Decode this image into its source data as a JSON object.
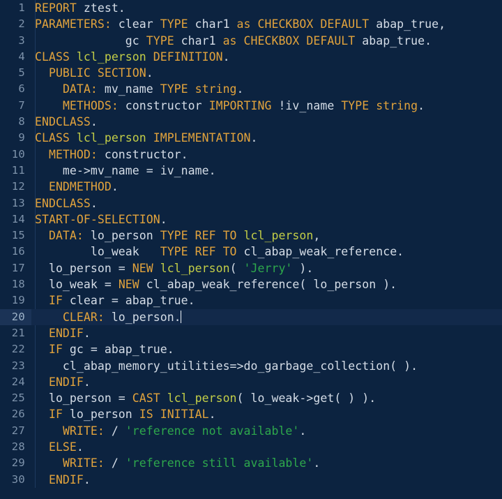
{
  "editor": {
    "name": "abap-code-editor",
    "language": "ABAP",
    "background_color": "#0c2340",
    "gutter_color": "#7e93ab",
    "active_line": 20,
    "cursor_line": 20,
    "cursor_column": 23,
    "first_visible_line": 1,
    "last_visible_line": 30,
    "total_visible_lines": 30,
    "colors": {
      "keyword": "#e2a33c",
      "class_name": "#c3ce47",
      "identifier": "#d5dde7",
      "string": "#2ea84c",
      "line_number": "#7e93ab",
      "active_line_bg": "#12294a",
      "active_gutter_bg": "#1b3356",
      "indent_guide": "#1e3a5f",
      "cursor": "#eef3f8"
    }
  },
  "lines": [
    {
      "n": 1,
      "indent": 0,
      "tokens": [
        {
          "t": "REPORT",
          "c": "kw"
        },
        {
          "t": " ztest.",
          "c": "id"
        }
      ]
    },
    {
      "n": 2,
      "indent": 0,
      "tokens": [
        {
          "t": "PARAMETERS:",
          "c": "kw"
        },
        {
          "t": " clear ",
          "c": "id"
        },
        {
          "t": "TYPE",
          "c": "kw"
        },
        {
          "t": " char1 ",
          "c": "id"
        },
        {
          "t": "as",
          "c": "kw"
        },
        {
          "t": " ",
          "c": "id"
        },
        {
          "t": "CHECKBOX DEFAULT",
          "c": "kw"
        },
        {
          "t": " abap_true,",
          "c": "id"
        }
      ]
    },
    {
      "n": 3,
      "indent": 0,
      "tokens": [
        {
          "t": "             gc ",
          "c": "id"
        },
        {
          "t": "TYPE",
          "c": "kw"
        },
        {
          "t": " char1 ",
          "c": "id"
        },
        {
          "t": "as",
          "c": "kw"
        },
        {
          "t": " ",
          "c": "id"
        },
        {
          "t": "CHECKBOX DEFAULT",
          "c": "kw"
        },
        {
          "t": " abap_true.",
          "c": "id"
        }
      ]
    },
    {
      "n": 4,
      "indent": 0,
      "tokens": [
        {
          "t": "CLASS",
          "c": "kw"
        },
        {
          "t": " ",
          "c": "id"
        },
        {
          "t": "lcl_person",
          "c": "cls"
        },
        {
          "t": " ",
          "c": "id"
        },
        {
          "t": "DEFINITION",
          "c": "kw"
        },
        {
          "t": ".",
          "c": "id"
        }
      ]
    },
    {
      "n": 5,
      "indent": 1,
      "tokens": [
        {
          "t": "  ",
          "c": "id"
        },
        {
          "t": "PUBLIC SECTION",
          "c": "kw"
        },
        {
          "t": ".",
          "c": "id"
        }
      ]
    },
    {
      "n": 6,
      "indent": 2,
      "tokens": [
        {
          "t": "    ",
          "c": "id"
        },
        {
          "t": "DATA:",
          "c": "kw"
        },
        {
          "t": " mv_name ",
          "c": "id"
        },
        {
          "t": "TYPE",
          "c": "kw"
        },
        {
          "t": " ",
          "c": "id"
        },
        {
          "t": "string",
          "c": "kw"
        },
        {
          "t": ".",
          "c": "id"
        }
      ]
    },
    {
      "n": 7,
      "indent": 2,
      "tokens": [
        {
          "t": "    ",
          "c": "id"
        },
        {
          "t": "METHODS:",
          "c": "kw"
        },
        {
          "t": " constructor ",
          "c": "id"
        },
        {
          "t": "IMPORTING",
          "c": "kw"
        },
        {
          "t": " !iv_name ",
          "c": "id"
        },
        {
          "t": "TYPE",
          "c": "kw"
        },
        {
          "t": " ",
          "c": "id"
        },
        {
          "t": "string",
          "c": "kw"
        },
        {
          "t": ".",
          "c": "id"
        }
      ]
    },
    {
      "n": 8,
      "indent": 0,
      "tokens": [
        {
          "t": "ENDCLASS",
          "c": "kw"
        },
        {
          "t": ".",
          "c": "id"
        }
      ]
    },
    {
      "n": 9,
      "indent": 0,
      "tokens": [
        {
          "t": "CLASS",
          "c": "kw"
        },
        {
          "t": " ",
          "c": "id"
        },
        {
          "t": "lcl_person",
          "c": "cls"
        },
        {
          "t": " ",
          "c": "id"
        },
        {
          "t": "IMPLEMENTATION",
          "c": "kw"
        },
        {
          "t": ".",
          "c": "id"
        }
      ]
    },
    {
      "n": 10,
      "indent": 1,
      "tokens": [
        {
          "t": "  ",
          "c": "id"
        },
        {
          "t": "METHOD:",
          "c": "kw"
        },
        {
          "t": " constructor.",
          "c": "id"
        }
      ]
    },
    {
      "n": 11,
      "indent": 2,
      "tokens": [
        {
          "t": "    me->mv_name = iv_name.",
          "c": "id"
        }
      ]
    },
    {
      "n": 12,
      "indent": 1,
      "tokens": [
        {
          "t": "  ",
          "c": "id"
        },
        {
          "t": "ENDMETHOD",
          "c": "kw"
        },
        {
          "t": ".",
          "c": "id"
        }
      ]
    },
    {
      "n": 13,
      "indent": 0,
      "tokens": [
        {
          "t": "ENDCLASS",
          "c": "kw"
        },
        {
          "t": ".",
          "c": "id"
        }
      ]
    },
    {
      "n": 14,
      "indent": 0,
      "tokens": [
        {
          "t": "START-OF-SELECTION",
          "c": "kw"
        },
        {
          "t": ".",
          "c": "id"
        }
      ]
    },
    {
      "n": 15,
      "indent": 1,
      "tokens": [
        {
          "t": "  ",
          "c": "id"
        },
        {
          "t": "DATA:",
          "c": "kw"
        },
        {
          "t": " lo_person ",
          "c": "id"
        },
        {
          "t": "TYPE REF TO",
          "c": "kw"
        },
        {
          "t": " ",
          "c": "id"
        },
        {
          "t": "lcl_person",
          "c": "cls"
        },
        {
          "t": ",",
          "c": "id"
        }
      ]
    },
    {
      "n": 16,
      "indent": 1,
      "tokens": [
        {
          "t": "        lo_weak   ",
          "c": "id"
        },
        {
          "t": "TYPE REF TO",
          "c": "kw"
        },
        {
          "t": " cl_abap_weak_reference.",
          "c": "id"
        }
      ]
    },
    {
      "n": 17,
      "indent": 1,
      "tokens": [
        {
          "t": "  lo_person = ",
          "c": "id"
        },
        {
          "t": "NEW",
          "c": "kw"
        },
        {
          "t": " ",
          "c": "id"
        },
        {
          "t": "lcl_person",
          "c": "cls"
        },
        {
          "t": "( ",
          "c": "id"
        },
        {
          "t": "'Jerry'",
          "c": "str"
        },
        {
          "t": " ).",
          "c": "id"
        }
      ]
    },
    {
      "n": 18,
      "indent": 1,
      "tokens": [
        {
          "t": "  lo_weak = ",
          "c": "id"
        },
        {
          "t": "NEW",
          "c": "kw"
        },
        {
          "t": " cl_abap_weak_reference( lo_person ).",
          "c": "id"
        }
      ]
    },
    {
      "n": 19,
      "indent": 1,
      "tokens": [
        {
          "t": "  ",
          "c": "id"
        },
        {
          "t": "IF",
          "c": "kw"
        },
        {
          "t": " clear = abap_true.",
          "c": "id"
        }
      ]
    },
    {
      "n": 20,
      "indent": 2,
      "tokens": [
        {
          "t": "    ",
          "c": "id"
        },
        {
          "t": "CLEAR:",
          "c": "kw"
        },
        {
          "t": " lo_person.",
          "c": "id"
        }
      ],
      "cursor_after": true
    },
    {
      "n": 21,
      "indent": 1,
      "tokens": [
        {
          "t": "  ",
          "c": "id"
        },
        {
          "t": "ENDIF",
          "c": "kw"
        },
        {
          "t": ".",
          "c": "id"
        }
      ]
    },
    {
      "n": 22,
      "indent": 1,
      "tokens": [
        {
          "t": "  ",
          "c": "id"
        },
        {
          "t": "IF",
          "c": "kw"
        },
        {
          "t": " gc = abap_true.",
          "c": "id"
        }
      ]
    },
    {
      "n": 23,
      "indent": 2,
      "tokens": [
        {
          "t": "    cl_abap_memory_utilities=>do_garbage_collection( ).",
          "c": "id"
        }
      ]
    },
    {
      "n": 24,
      "indent": 1,
      "tokens": [
        {
          "t": "  ",
          "c": "id"
        },
        {
          "t": "ENDIF",
          "c": "kw"
        },
        {
          "t": ".",
          "c": "id"
        }
      ]
    },
    {
      "n": 25,
      "indent": 1,
      "tokens": [
        {
          "t": "  lo_person = ",
          "c": "id"
        },
        {
          "t": "CAST",
          "c": "kw"
        },
        {
          "t": " ",
          "c": "id"
        },
        {
          "t": "lcl_person",
          "c": "cls"
        },
        {
          "t": "( lo_weak->get( ) ).",
          "c": "id"
        }
      ]
    },
    {
      "n": 26,
      "indent": 1,
      "tokens": [
        {
          "t": "  ",
          "c": "id"
        },
        {
          "t": "IF",
          "c": "kw"
        },
        {
          "t": " lo_person ",
          "c": "id"
        },
        {
          "t": "IS INITIAL",
          "c": "kw"
        },
        {
          "t": ".",
          "c": "id"
        }
      ]
    },
    {
      "n": 27,
      "indent": 2,
      "tokens": [
        {
          "t": "    ",
          "c": "id"
        },
        {
          "t": "WRITE:",
          "c": "kw"
        },
        {
          "t": " / ",
          "c": "id"
        },
        {
          "t": "'reference not available'",
          "c": "str"
        },
        {
          "t": ".",
          "c": "id"
        }
      ]
    },
    {
      "n": 28,
      "indent": 1,
      "tokens": [
        {
          "t": "  ",
          "c": "id"
        },
        {
          "t": "ELSE",
          "c": "kw"
        },
        {
          "t": ".",
          "c": "id"
        }
      ]
    },
    {
      "n": 29,
      "indent": 2,
      "tokens": [
        {
          "t": "    ",
          "c": "id"
        },
        {
          "t": "WRITE:",
          "c": "kw"
        },
        {
          "t": " / ",
          "c": "id"
        },
        {
          "t": "'reference still available'",
          "c": "str"
        },
        {
          "t": ".",
          "c": "id"
        }
      ]
    },
    {
      "n": 30,
      "indent": 1,
      "tokens": [
        {
          "t": "  ",
          "c": "id"
        },
        {
          "t": "ENDIF",
          "c": "kw"
        },
        {
          "t": ".",
          "c": "id"
        }
      ]
    }
  ]
}
